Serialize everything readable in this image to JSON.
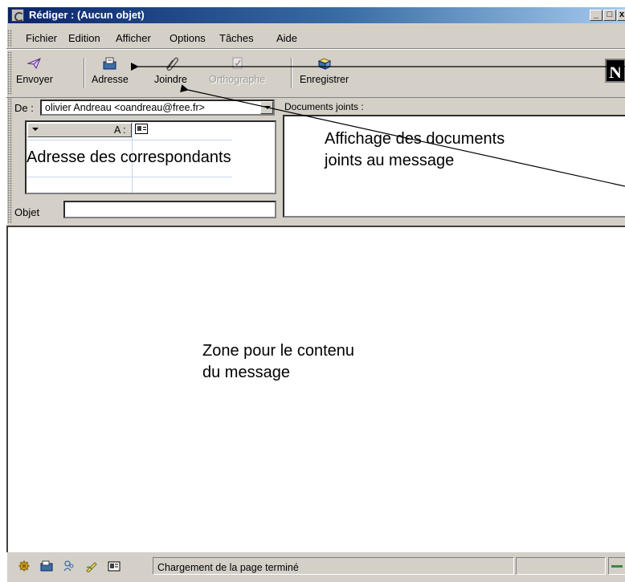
{
  "window": {
    "title": "Rédiger : (Aucun objet)",
    "controls": [
      "_",
      "□",
      "x"
    ]
  },
  "menu": [
    "Fichier",
    "Edition",
    "Afficher",
    "Options",
    "Tâches",
    "Aide"
  ],
  "toolbar": {
    "send": "Envoyer",
    "address": "Adresse",
    "attach": "Joindre",
    "spelling": "Orthographe",
    "save": "Enregistrer",
    "logo": "N"
  },
  "header": {
    "from_label": "De :",
    "from_value": "olivier Andreau <oandreau@free.fr>",
    "recipient_type": "A :",
    "subject_label": "Objet",
    "subject_value": "",
    "attachments_label": "Documents joints :"
  },
  "annotations": {
    "addresses": "Adresse des correspondants",
    "attachments_line1": "Affichage des documents",
    "attachments_line2": "joints au message",
    "body_line1": "Zone pour le contenu",
    "body_line2": "du message"
  },
  "status": {
    "text": "Chargement de la page terminé"
  }
}
